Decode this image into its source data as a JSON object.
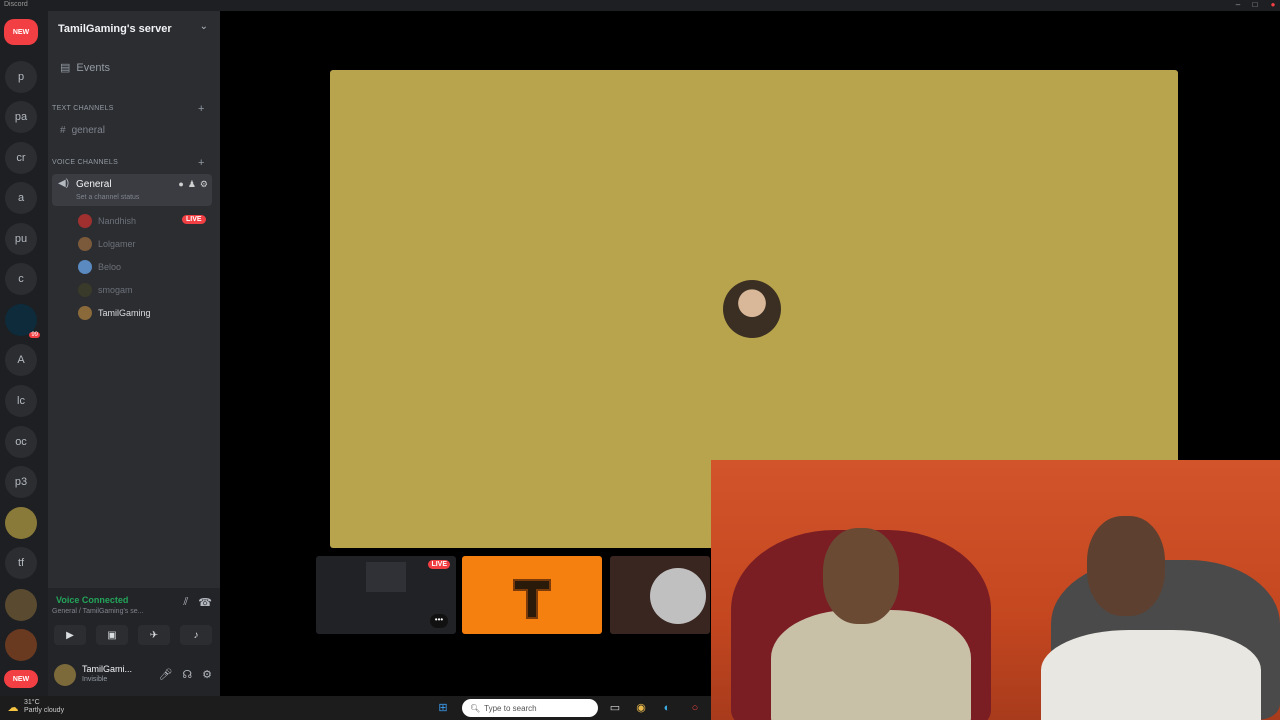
{
  "window": {
    "app_title": "Discord"
  },
  "rail": {
    "new_badge": "NEW",
    "servers": [
      "p",
      "pa",
      "cr",
      "a",
      "pu",
      "c",
      "A",
      "lc",
      "oc",
      "p3",
      "tf"
    ],
    "notif_count": "99",
    "bottom_new": "NEW"
  },
  "server": {
    "name": "TamilGaming's server"
  },
  "events_label": "Events",
  "categories": {
    "text": "TEXT CHANNELS",
    "voice": "VOICE CHANNELS"
  },
  "text_channels": [
    "general"
  ],
  "voice_channel": {
    "name": "General",
    "status": "Set a channel status"
  },
  "members": [
    {
      "name": "Nandhish",
      "live": true
    },
    {
      "name": "Lolgamer",
      "live": false
    },
    {
      "name": "Beloo",
      "live": false
    },
    {
      "name": "smogam",
      "live": false
    },
    {
      "name": "TamilGaming",
      "live": false
    }
  ],
  "live_badge": "LIVE",
  "voice_connected": {
    "title": "Voice Connected",
    "subtitle": "General / TamilGaming's se..."
  },
  "user": {
    "name": "TamilGami...",
    "status": "Invisible"
  },
  "thumbs": {
    "live_badge": "LIVE",
    "more": "•••"
  },
  "taskbar": {
    "temp": "31°C",
    "weather": "Partly cloudy",
    "search_placeholder": "Type to search"
  },
  "colors": {
    "stage_bg": "#b8a44c",
    "live_red": "#f23f43",
    "voice_green": "#23a55a",
    "sidebar": "#2b2d31"
  }
}
